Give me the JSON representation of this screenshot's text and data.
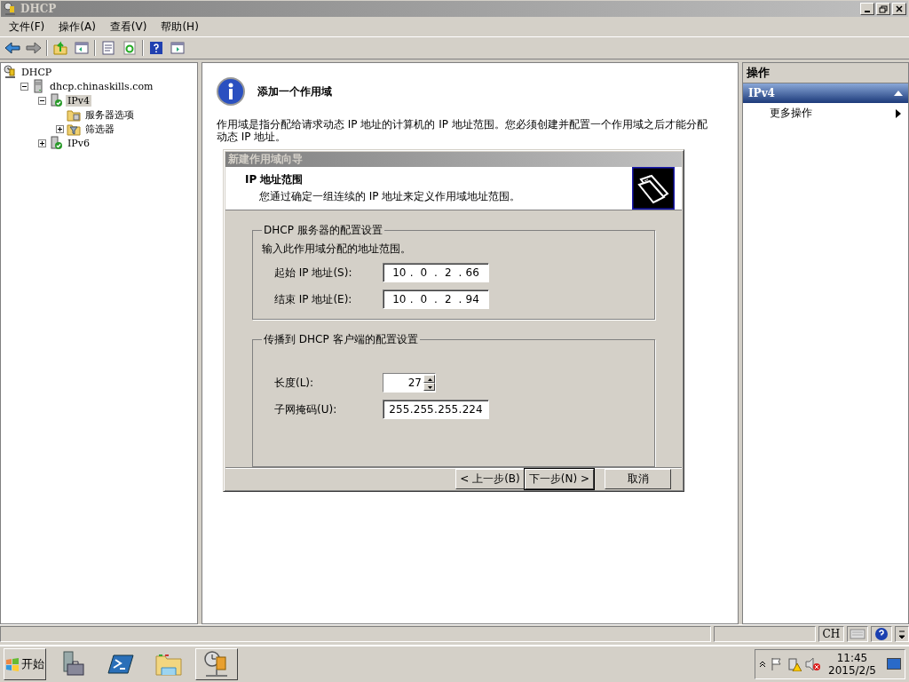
{
  "window": {
    "title": "DHCP"
  },
  "menu": [
    "文件(F)",
    "操作(A)",
    "查看(V)",
    "帮助(H)"
  ],
  "tree": [
    {
      "label": "DHCP",
      "kind": "root",
      "selected": false,
      "children": [
        {
          "label": "dhcp.chinaskills.com",
          "kind": "server",
          "expanded": true,
          "selected": false,
          "children": [
            {
              "label": "IPv4",
              "kind": "protocol",
              "expanded": true,
              "selected": true,
              "children": [
                {
                  "label": "服务器选项",
                  "kind": "folder",
                  "selected": false
                },
                {
                  "label": "筛选器",
                  "kind": "filter",
                  "expanded": false,
                  "selected": false
                }
              ]
            },
            {
              "label": "IPv6",
              "kind": "protocol",
              "expanded": false,
              "selected": false
            }
          ]
        }
      ]
    }
  ],
  "content": {
    "heading": "添加一个作用域",
    "description": "作用域是指分配给请求动态 IP 地址的计算机的 IP 地址范围。您必须创建并配置一个作用域之后才能分配动态 IP 地址。"
  },
  "wizard": {
    "title": "新建作用域向导",
    "header_title": "IP 地址范围",
    "header_subtitle": "您通过确定一组连续的 IP 地址来定义作用域地址范围。",
    "groups": [
      {
        "legend": "DHCP 服务器的配置设置",
        "intro": "输入此作用域分配的地址范围。",
        "fields": [
          {
            "label": "起始 IP 地址(S):",
            "kind": "ip",
            "separator": ".",
            "octets": [
              "10",
              "0",
              "2",
              "66"
            ]
          },
          {
            "label": "结束 IP 地址(E):",
            "kind": "ip",
            "separator": ".",
            "octets": [
              "10",
              "0",
              "2",
              "94"
            ]
          }
        ]
      },
      {
        "legend": "传播到 DHCP 客户端的配置设置",
        "fields": [
          {
            "label": "长度(L):",
            "kind": "spin",
            "value": "27"
          },
          {
            "label": "子网掩码(U):",
            "kind": "ip",
            "separator": ".",
            "octets": [
              "255",
              "255",
              "255",
              "224"
            ]
          }
        ]
      }
    ],
    "buttons": [
      {
        "label": "< 上一步(B)",
        "default": false
      },
      {
        "label": "下一步(N) >",
        "default": true
      },
      {
        "label": "取消",
        "default": false
      }
    ]
  },
  "actions": {
    "header": "操作",
    "section": "IPv4",
    "items": [
      "更多操作"
    ]
  },
  "status_bar": {
    "language": "CH"
  },
  "taskbar": {
    "start": "开始",
    "apps": [
      {
        "kind": "server-manager",
        "selected": false
      },
      {
        "kind": "powershell",
        "selected": false
      },
      {
        "kind": "explorer",
        "selected": false
      },
      {
        "kind": "dhcp",
        "selected": true
      }
    ],
    "time": "11:45",
    "date": "2015/2/5"
  }
}
